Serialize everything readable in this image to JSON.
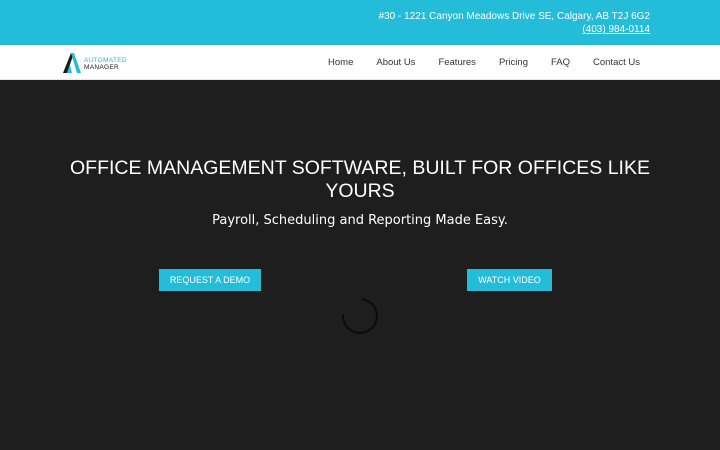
{
  "topbar": {
    "address": "#30 - 1221 Canyon Meadows Drive SE, Calgary, AB T2J 6G2",
    "phone": "(403) 984-0114",
    "color": "#23bcd9"
  },
  "logo": {
    "line1": "Automated",
    "line2": "Manager",
    "icon": "logo-mark-icon"
  },
  "nav": {
    "items": [
      "Home",
      "About Us",
      "Features",
      "Pricing",
      "FAQ",
      "Contact Us"
    ]
  },
  "hero": {
    "title": "OFFICE MANAGEMENT SOFTWARE, BUILT FOR OFFICES LIKE YOURS",
    "subtitle": "Payroll, Scheduling and Reporting Made Easy.",
    "demo_button": "REQUEST A DEMO",
    "video_button": "WATCH VIDEO",
    "background": "#1e1e1f",
    "loading_icon": "spinner-icon"
  }
}
